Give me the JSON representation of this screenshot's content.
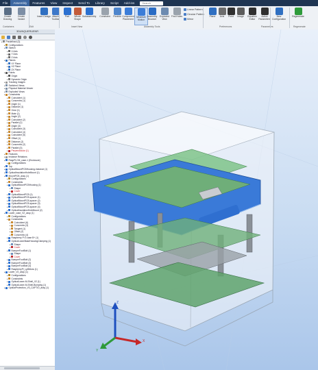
{
  "menubar": {
    "items": [
      "File",
      "Assembly",
      "Features",
      "View",
      "Inspect",
      "Send To",
      "Library",
      "Script",
      "Add-ins"
    ],
    "active_index": 1,
    "search_placeholder": "Search"
  },
  "ribbon": {
    "buttons": [
      {
        "label": "Create Drawing",
        "color": "#5a6e86"
      },
      {
        "label": "Create Variant",
        "color": "#7c8ea5"
      },
      {
        "label": "Insert Design",
        "color": "#2f6fc1"
      },
      {
        "label": "Attach Toolbar",
        "color": "#3d78c9"
      },
      {
        "label": "Part",
        "color": "#2b70d0"
      },
      {
        "label": "Whole Shape",
        "color": "#c25b3a"
      },
      {
        "label": "Subassembly",
        "color": "#2b70d0"
      },
      {
        "label": "Constraint",
        "color": "#9aa3ad"
      },
      {
        "label": "Flexible",
        "color": "#4d85cc"
      },
      {
        "label": "Component Placement",
        "color": "#3b7dd8"
      },
      {
        "label": "Minimize Motion",
        "color": "#3b7dd8"
      },
      {
        "label": "Assembly Browser",
        "color": "#2a6cc4"
      },
      {
        "label": "Exploded View",
        "color": "#6d8bb0"
      },
      {
        "label": "Find Holes",
        "color": "#9aa3ad"
      },
      {
        "label": "Plane",
        "color": "#2f6fc1"
      },
      {
        "label": "Axis",
        "color": "#6d6d6d"
      },
      {
        "label": "Point",
        "color": "#2f2f2f"
      },
      {
        "label": "Image",
        "color": "#5b5b5b"
      },
      {
        "label": "Equation Editor",
        "color": "#2f2f2f"
      },
      {
        "label": "Active Parameters",
        "color": "#2f2f2f"
      },
      {
        "label": "New Configuration",
        "color": "#2f6fc1"
      },
      {
        "label": "Regenerate",
        "color": "#2e9b3b"
      }
    ],
    "small_commands": [
      "Linear Pattern",
      "Circular Pattern",
      "Mirror"
    ],
    "groups": [
      "Containers",
      "Edit",
      "Insert New",
      "Assembly Tools",
      "Preferences",
      "Parameters",
      "Regenerate"
    ]
  },
  "tree": {
    "header": "3DUNQUERUENR",
    "rows": [
      {
        "depth": 0,
        "label": "Predefined (3)",
        "icon": "#888888",
        "red": false
      },
      {
        "depth": 1,
        "label": "Configurations",
        "icon": "#b58b2a",
        "red": false
      },
      {
        "depth": 1,
        "label": "Sketch",
        "icon": "#6b8db8",
        "red": false
      },
      {
        "depth": 2,
        "label": "X Axis",
        "icon": "#6a6a6a",
        "red": false
      },
      {
        "depth": 2,
        "label": "Y Axis",
        "icon": "#6a6a6a",
        "red": false
      },
      {
        "depth": 2,
        "label": "Z Axis",
        "icon": "#6a6a6a",
        "red": false
      },
      {
        "depth": 1,
        "label": "Planes",
        "icon": "#2f6fc1",
        "red": false
      },
      {
        "depth": 2,
        "label": "XY Plane",
        "icon": "#2f6fc1",
        "red": false
      },
      {
        "depth": 2,
        "label": "XZ Plane",
        "icon": "#2f6fc1",
        "red": false
      },
      {
        "depth": 2,
        "label": "ZX Plane",
        "icon": "#2f6fc1",
        "red": false
      },
      {
        "depth": 1,
        "label": "Points",
        "icon": "#555555",
        "red": false
      },
      {
        "depth": 2,
        "label": "Origin",
        "icon": "#555555",
        "red": false
      },
      {
        "depth": 2,
        "label": "Dynamic Origin",
        "icon": "#777777",
        "red": false
      },
      {
        "depth": 1,
        "label": "Tracking Images",
        "icon": "#999999",
        "red": false
      },
      {
        "depth": 1,
        "label": "Switched Views",
        "icon": "#7b8fa6",
        "red": false
      },
      {
        "depth": 1,
        "label": "Physical Material Viewer",
        "icon": "#7b8fa6",
        "red": false
      },
      {
        "depth": 1,
        "label": "Exploded Views",
        "icon": "#7b8fa6",
        "red": false
      },
      {
        "depth": 1,
        "label": "Constraints",
        "icon": "#c7862b",
        "red": false
      },
      {
        "depth": 2,
        "label": "Coincident (1)",
        "icon": "#c7862b",
        "red": false
      },
      {
        "depth": 2,
        "label": "Concentric (1)",
        "icon": "#c7862b",
        "red": false
      },
      {
        "depth": 2,
        "label": "Angle (1)",
        "icon": "#c7862b",
        "red": false
      },
      {
        "depth": 2,
        "label": "Distance (1)",
        "icon": "#c7862b",
        "red": false
      },
      {
        "depth": 2,
        "label": "Gear (1)",
        "icon": "#c7862b",
        "red": false
      },
      {
        "depth": 2,
        "label": "Mate (1)",
        "icon": "#c7862b",
        "red": false
      },
      {
        "depth": 2,
        "label": "Angle (2)",
        "icon": "#c7862b",
        "red": false
      },
      {
        "depth": 2,
        "label": "Coincident (2)",
        "icon": "#c7862b",
        "red": false
      },
      {
        "depth": 2,
        "label": "Parallel (2)",
        "icon": "#c7862b",
        "red": false
      },
      {
        "depth": 2,
        "label": "Angle (3)",
        "icon": "#c7862b",
        "red": false
      },
      {
        "depth": 2,
        "label": "Coincident (3)",
        "icon": "#c7862b",
        "red": false
      },
      {
        "depth": 2,
        "label": "Coincident (4)",
        "icon": "#c7862b",
        "red": false
      },
      {
        "depth": 2,
        "label": "Coincident (5)",
        "icon": "#c7862b",
        "red": false
      },
      {
        "depth": 2,
        "label": "Offset (1)",
        "icon": "#c7862b",
        "red": false
      },
      {
        "depth": 2,
        "label": "Distance (2)",
        "icon": "#c7862b",
        "red": false
      },
      {
        "depth": 2,
        "label": "Concentric (2)",
        "icon": "#c7862b",
        "red": false
      },
      {
        "depth": 2,
        "label": "Parallel (3)",
        "icon": "#c7862b",
        "red": false
      },
      {
        "depth": 2,
        "label": "Perpendicular (1)",
        "icon": "#c0262d",
        "red": true
      },
      {
        "depth": 1,
        "label": "Features",
        "icon": "#c7862b",
        "red": false
      },
      {
        "depth": 1,
        "label": "Instance Relations",
        "icon": "#999999",
        "red": false
      },
      {
        "depth": 1,
        "label": "RaspPi-CM_case-1 (Enclosure)",
        "icon": "#2b70d0",
        "red": false
      },
      {
        "depth": 2,
        "label": "Configurations",
        "icon": "#b58b2a",
        "red": false
      },
      {
        "depth": 1,
        "label": "Top",
        "icon": "#2b70d0",
        "red": false
      },
      {
        "depth": 1,
        "label": "OpticalMountPCBHousing-Instance (1)",
        "icon": "#2b70d0",
        "red": false
      },
      {
        "depth": 1,
        "label": "OpticalInsulationHoleMount (1)",
        "icon": "#2b70d0",
        "red": false
      },
      {
        "depth": 1,
        "label": "MountPCB_assy (1)",
        "icon": "#2b70d0",
        "red": false
      },
      {
        "depth": 2,
        "label": "Configurations",
        "icon": "#b58b2a",
        "red": false
      },
      {
        "depth": 2,
        "label": "Constraints",
        "icon": "#c7862b",
        "red": false
      },
      {
        "depth": 2,
        "label": "OpticalMountPCBHousing (1)",
        "icon": "#2b70d0",
        "red": false
      },
      {
        "depth": 3,
        "label": "Shape",
        "icon": "#6b8db8",
        "red": false
      },
      {
        "depth": 3,
        "label": "Cover",
        "icon": "#c0262d",
        "red": true
      },
      {
        "depth": 2,
        "label": "OpticalMountPCB (1)",
        "icon": "#2b70d0",
        "red": false
      },
      {
        "depth": 2,
        "label": "OpticalMountPCB-spacer (1)",
        "icon": "#2b70d0",
        "red": false
      },
      {
        "depth": 2,
        "label": "OpticalMountPCB-spacer (2)",
        "icon": "#2b70d0",
        "red": false
      },
      {
        "depth": 2,
        "label": "OpticalMountPCB-spacer (3)",
        "icon": "#2b70d0",
        "red": false
      },
      {
        "depth": 2,
        "label": "OpticalMountPCB-spacer (4)",
        "icon": "#2b70d0",
        "red": false
      },
      {
        "depth": 2,
        "label": "OpticalInsulationHoleMount (2)",
        "icon": "#2b70d0",
        "red": false
      },
      {
        "depth": 1,
        "label": "Lower_case_V2_assy (1)",
        "icon": "#2b70d0",
        "red": false
      },
      {
        "depth": 2,
        "label": "Configurations",
        "icon": "#b58b2a",
        "red": false
      },
      {
        "depth": 2,
        "label": "Constraints",
        "icon": "#c7862b",
        "red": false
      },
      {
        "depth": 3,
        "label": "Coincident (6)",
        "icon": "#c7862b",
        "red": false
      },
      {
        "depth": 3,
        "label": "Concentric (3)",
        "icon": "#c7862b",
        "red": false
      },
      {
        "depth": 3,
        "label": "Tangent (1)",
        "icon": "#c7862b",
        "red": false
      },
      {
        "depth": 3,
        "label": "Offset (2)",
        "icon": "#c7862b",
        "red": false
      },
      {
        "depth": 3,
        "label": "Concentric (4)",
        "icon": "#c7862b",
        "red": false
      },
      {
        "depth": 2,
        "label": "Raspberry Pi 3 case B+ (1)",
        "icon": "#2b70d0",
        "red": false
      },
      {
        "depth": 2,
        "label": "OpticalLowerBaseHousingClamping (1)",
        "icon": "#2b70d0",
        "red": false
      },
      {
        "depth": 3,
        "label": "Shape",
        "icon": "#6b8db8",
        "red": false
      },
      {
        "depth": 3,
        "label": "Cover",
        "icon": "#c0262d",
        "red": true
      },
      {
        "depth": 2,
        "label": "BumperFootBolt (1)",
        "icon": "#2b70d0",
        "red": false
      },
      {
        "depth": 3,
        "label": "Shape",
        "icon": "#6b8db8",
        "red": false
      },
      {
        "depth": 3,
        "label": "Cover",
        "icon": "#c0262d",
        "red": true
      },
      {
        "depth": 2,
        "label": "BumperFootBolt (2)",
        "icon": "#2b70d0",
        "red": false
      },
      {
        "depth": 2,
        "label": "BumperFootBolt (3)",
        "icon": "#2b70d0",
        "red": false
      },
      {
        "depth": 2,
        "label": "BumperFootBolt (4)",
        "icon": "#2b70d0",
        "red": false
      },
      {
        "depth": 2,
        "label": "RaspberryPi_LpB6kxw (1)",
        "icon": "#2b70d0",
        "red": false
      },
      {
        "depth": 1,
        "label": "Lower_V2_assy (1)",
        "icon": "#2b70d0",
        "red": false
      },
      {
        "depth": 2,
        "label": "Configurations",
        "icon": "#b58b2a",
        "red": false
      },
      {
        "depth": 2,
        "label": "Constraints",
        "icon": "#c7862b",
        "red": false
      },
      {
        "depth": 2,
        "label": "OpticalLower-M-Shell_V2 (1)",
        "icon": "#2b70d0",
        "red": false
      },
      {
        "depth": 2,
        "label": "OpticalLower-M-Shell-Bumping (1)",
        "icon": "#2b70d0",
        "red": false
      },
      {
        "depth": 1,
        "label": "OpticalProtection_V3_CAPTIO_assy (1)",
        "icon": "#2b70d0",
        "red": false
      }
    ]
  },
  "viewport": {
    "axes": {
      "x": "X",
      "y": "Y",
      "z": "Z"
    }
  }
}
